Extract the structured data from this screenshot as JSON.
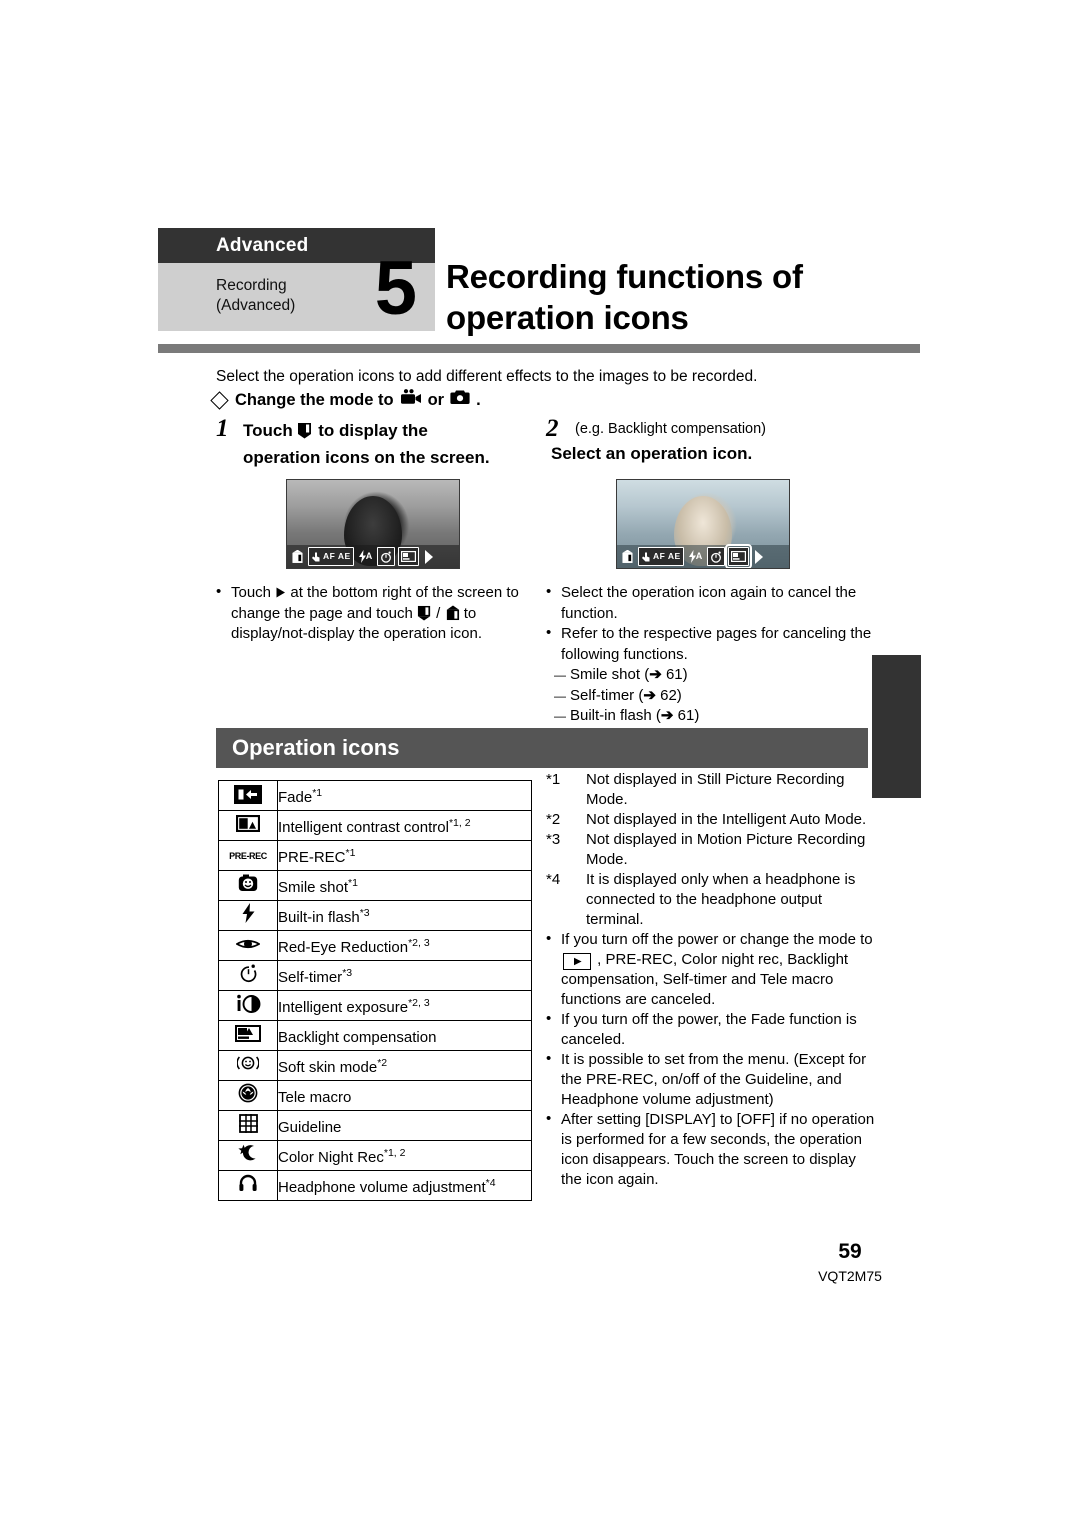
{
  "chapter": {
    "banner_label": "Advanced",
    "sub_line1": "Recording",
    "sub_line2": "(Advanced)",
    "number": "5",
    "title_line1": "Recording functions of",
    "title_line2": "operation icons"
  },
  "intro": {
    "lead": "Select the operation icons to add different effects to the images to be recorded.",
    "mode_prefix": "Change the mode to",
    "mode_conjunction": "or",
    "mode_suffix": "."
  },
  "steps": [
    {
      "number": "1",
      "text_line1": "Touch",
      "text_line2": "to display the",
      "text_line3": "operation icons on the screen.",
      "subtitle": ""
    },
    {
      "number": "2",
      "subtitle": "(e.g. Backlight compensation)",
      "text_line1": "Select an operation icon."
    }
  ],
  "screens": {
    "screen1": {
      "icons": [
        {
          "name": "flag-up-icon",
          "label": "⚑",
          "style": "plain",
          "selected": false
        },
        {
          "name": "af-ae-icon",
          "label": "AF AE",
          "style": "box",
          "selected": false
        },
        {
          "name": "flash-auto-icon",
          "label": "⚡A",
          "style": "plain",
          "selected": false
        },
        {
          "name": "self-timer-icon",
          "label": "↻",
          "style": "box",
          "selected": false
        },
        {
          "name": "backlight-compensation-icon",
          "label": "▤",
          "style": "box",
          "selected": false
        },
        {
          "name": "next-page-arrow-icon",
          "label": "▶",
          "style": "plain",
          "selected": false
        }
      ]
    },
    "screen2": {
      "icons": [
        {
          "name": "flag-up-icon",
          "label": "⚑",
          "style": "plain",
          "selected": false
        },
        {
          "name": "af-ae-icon",
          "label": "AF AE",
          "style": "box",
          "selected": false
        },
        {
          "name": "flash-auto-icon",
          "label": "⚡A",
          "style": "plain",
          "selected": false
        },
        {
          "name": "self-timer-icon",
          "label": "↻",
          "style": "box",
          "selected": false
        },
        {
          "name": "backlight-compensation-icon",
          "label": "▤",
          "style": "box",
          "selected": true
        },
        {
          "name": "next-page-arrow-icon",
          "label": "▶",
          "style": "plain",
          "selected": false
        }
      ]
    }
  },
  "bullets_left": [
    {
      "part1": "Touch",
      "part2": "at the bottom right of the screen to change the page and touch",
      "part3": "/",
      "part4": "to display/not-display the operation icon."
    }
  ],
  "bullets_right": [
    {
      "text": "Select the operation icon again to cancel the function."
    },
    {
      "text": "Refer to the respective pages for canceling the following functions."
    }
  ],
  "bullets_right_subitems": [
    {
      "label": "Smile shot",
      "ref": "61"
    },
    {
      "label": "Self-timer",
      "ref": "62"
    },
    {
      "label": "Built-in flash",
      "ref": "61"
    }
  ],
  "section": {
    "title": "Operation icons"
  },
  "icon_table": {
    "rows": [
      {
        "icon": "fade-icon",
        "label": "Fade",
        "notes": "*1"
      },
      {
        "icon": "intelligent-contrast-icon",
        "label": "Intelligent contrast control",
        "notes": "*1, 2"
      },
      {
        "icon": "pre-rec-icon",
        "label": "PRE-REC",
        "notes": "*1"
      },
      {
        "icon": "smile-shot-icon",
        "label": "Smile shot",
        "notes": "*1"
      },
      {
        "icon": "built-in-flash-icon",
        "label": "Built-in flash",
        "notes": "*3"
      },
      {
        "icon": "red-eye-reduction-icon",
        "label": "Red-Eye Reduction",
        "notes": "*2, 3"
      },
      {
        "icon": "self-timer-icon",
        "label": "Self-timer",
        "notes": "*3"
      },
      {
        "icon": "intelligent-exposure-icon",
        "label": "Intelligent exposure",
        "notes": "*2, 3"
      },
      {
        "icon": "backlight-compensation-icon",
        "label": "Backlight compensation",
        "notes": ""
      },
      {
        "icon": "soft-skin-mode-icon",
        "label": "Soft skin mode",
        "notes": "*2"
      },
      {
        "icon": "tele-macro-icon",
        "label": "Tele macro",
        "notes": ""
      },
      {
        "icon": "guideline-icon",
        "label": "Guideline",
        "notes": ""
      },
      {
        "icon": "color-night-rec-icon",
        "label": "Color Night Rec",
        "notes": "*1, 2"
      },
      {
        "icon": "headphone-volume-icon",
        "label": "Headphone volume adjustment",
        "notes": "*4"
      }
    ],
    "pre_rec_glyph_text": "PRE-REC"
  },
  "footnotes": [
    {
      "mark": "*1",
      "text": "Not displayed in Still Picture Recording Mode."
    },
    {
      "mark": "*2",
      "text": "Not displayed in the Intelligent Auto Mode."
    },
    {
      "mark": "*3",
      "text": "Not displayed in Motion Picture Recording Mode."
    },
    {
      "mark": "*4",
      "text": "It is displayed only when a headphone is connected to the headphone output terminal."
    }
  ],
  "notes_bullets": [
    {
      "part1": "If you turn off the power or change the mode to",
      "part2": ", PRE-REC, Color night rec, Backlight compensation, Self-timer and Tele macro functions are canceled."
    },
    {
      "text": "If you turn off the power, the Fade function is canceled."
    },
    {
      "text": "It is possible to set from the menu. (Except for the PRE-REC, on/off of the Guideline, and Headphone volume adjustment)"
    },
    {
      "text": "After setting [DISPLAY] to [OFF] if no operation is performed for a few seconds, the operation icon disappears. Touch the screen to display the icon again."
    }
  ],
  "footer": {
    "page_number": "59",
    "doc_code": "VQT2M75"
  },
  "colors": {
    "banner_dark": "#333333",
    "banner_light": "#cfcfcf",
    "rule_grey": "#7a7a7a",
    "section_grey": "#555555",
    "tab_dark": "#333333"
  }
}
